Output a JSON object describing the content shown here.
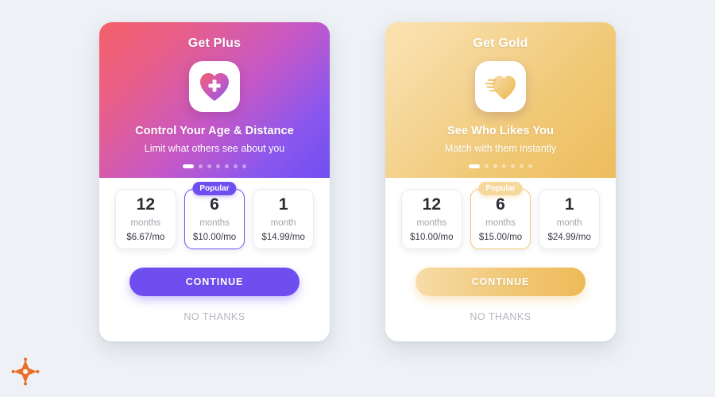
{
  "page": {
    "background_color": "#eef1f5",
    "brand_logo_icon": "star-burst-logo-icon",
    "brand_logo_color": "#e8702a"
  },
  "cards": [
    {
      "id": "plus",
      "title": "Get Plus",
      "icon": "heart-plus-icon",
      "headline": "Control Your Age & Distance",
      "subtitle": "Limit what others see about you",
      "accent_color": "#6f4ef0",
      "gradient_from": "#f4606a",
      "gradient_to": "#6f4ef0",
      "pagination": {
        "total": 7,
        "active_index": 0
      },
      "badge_label": "Popular",
      "tiers": [
        {
          "number": "12",
          "unit": "months",
          "price": "$6.67/mo",
          "selected": false,
          "popular": false
        },
        {
          "number": "6",
          "unit": "months",
          "price": "$10.00/mo",
          "selected": true,
          "popular": true
        },
        {
          "number": "1",
          "unit": "month",
          "price": "$14.99/mo",
          "selected": false,
          "popular": false
        }
      ],
      "cta_label": "CONTINUE",
      "dismiss_label": "NO THANKS"
    },
    {
      "id": "gold",
      "title": "Get Gold",
      "icon": "heart-speed-icon",
      "headline": "See Who Likes You",
      "subtitle": "Match with them instantly",
      "accent_color": "#f0c874",
      "gradient_from": "#fbe3b2",
      "gradient_to": "#edbd5d",
      "pagination": {
        "total": 7,
        "active_index": 0
      },
      "badge_label": "Popular",
      "tiers": [
        {
          "number": "12",
          "unit": "months",
          "price": "$10.00/mo",
          "selected": false,
          "popular": false
        },
        {
          "number": "6",
          "unit": "months",
          "price": "$15.00/mo",
          "selected": true,
          "popular": true
        },
        {
          "number": "1",
          "unit": "month",
          "price": "$24.99/mo",
          "selected": false,
          "popular": false
        }
      ],
      "cta_label": "CONTINUE",
      "dismiss_label": "NO THANKS"
    }
  ]
}
